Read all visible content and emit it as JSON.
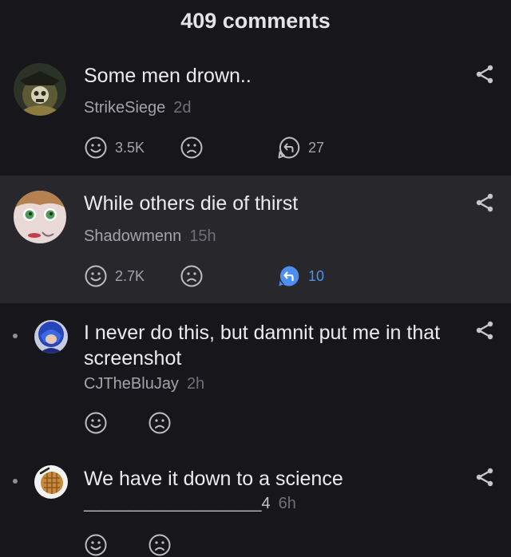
{
  "header": {
    "title": "409 comments"
  },
  "comments": [
    {
      "text": "Some men drown..",
      "author": "StrikeSiege",
      "time": "2d",
      "likes": "3.5K",
      "replies": "27"
    },
    {
      "text": "While others die of thirst",
      "author": "Shadowmenn",
      "time": "15h",
      "likes": "2.7K",
      "replies": "10"
    },
    {
      "text": "I never do this, but damnit put me in that screenshot",
      "author": "CJTheBluJay",
      "time": "2h"
    },
    {
      "text": "We have it down to a science",
      "author": "____________________4",
      "time": "6h"
    }
  ],
  "colors": {
    "background": "#17171b",
    "highlight_background": "#27272c",
    "reply_accent": "#4d8ff0"
  },
  "icons": [
    "smile-icon",
    "frown-icon",
    "reply-icon",
    "share-icon"
  ]
}
